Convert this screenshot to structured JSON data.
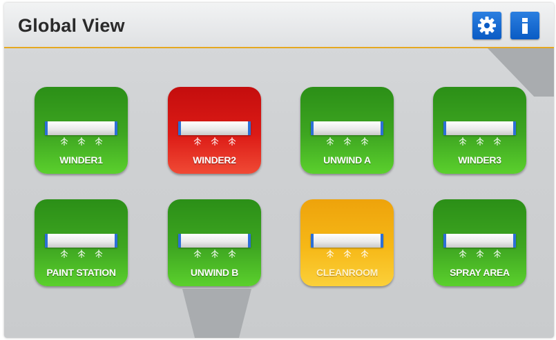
{
  "header": {
    "title": "Global View",
    "settings_icon": "gear-icon",
    "info_icon": "info-icon",
    "accent_color": "#e5a820",
    "button_color": "#0a5bc4"
  },
  "zones": [
    {
      "label": "WINDER1",
      "status": "green",
      "color": "#3ea621"
    },
    {
      "label": "WINDER2",
      "status": "red",
      "color": "#dc1b16"
    },
    {
      "label": "UNWIND A",
      "status": "green",
      "color": "#3ea621"
    },
    {
      "label": "WINDER3",
      "status": "green",
      "color": "#3ea621"
    },
    {
      "label": "PAINT STATION",
      "status": "green",
      "color": "#3ea621"
    },
    {
      "label": "UNWIND B",
      "status": "green",
      "color": "#3ea621"
    },
    {
      "label": "CLEANROOM",
      "status": "yellow",
      "color": "#f6b817"
    },
    {
      "label": "SPRAY AREA",
      "status": "green",
      "color": "#3ea621"
    }
  ],
  "zone_icon": "air-curtain-icon"
}
